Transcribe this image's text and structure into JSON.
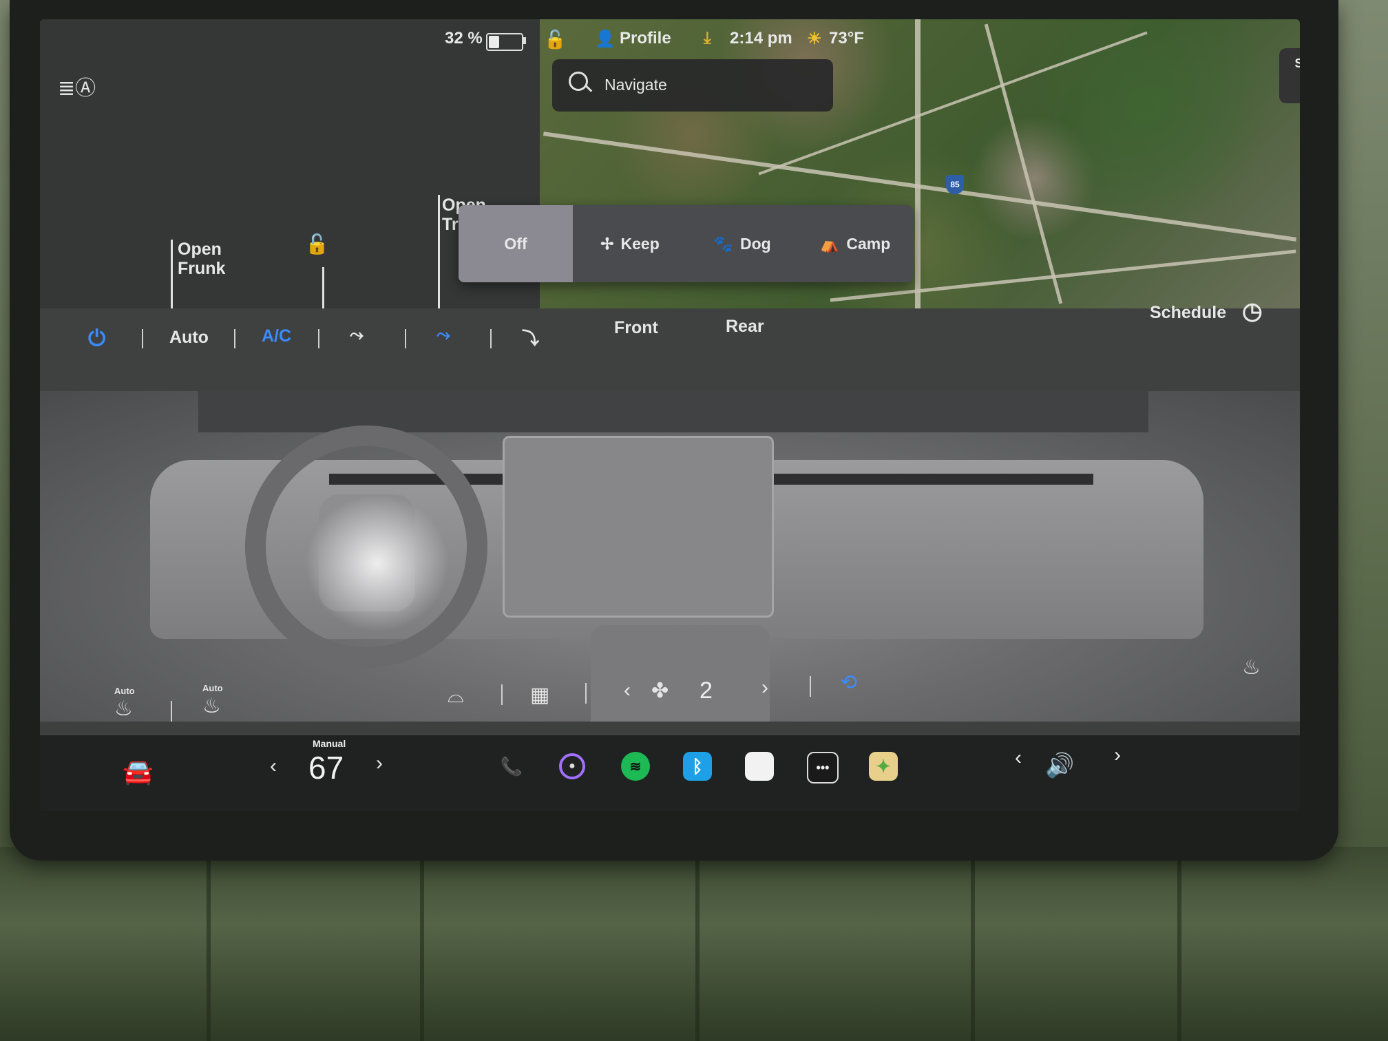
{
  "status_bar": {
    "battery_percent": "32 %",
    "battery_level": 0.32,
    "profile_label": "Profile",
    "time": "2:14 pm",
    "temperature": "73°F"
  },
  "left_panel": {
    "frunk_label": "Open\nFrunk",
    "trunk_label": "Open\nTr"
  },
  "map": {
    "search_placeholder": "Navigate",
    "compass_label": "SW",
    "highway_shield": "85"
  },
  "mode_popup": {
    "options": [
      "Off",
      "Keep",
      "Dog",
      "Camp"
    ],
    "selected": "Off"
  },
  "climate": {
    "auto_label": "Auto",
    "ac_label": "A/C",
    "front_label": "Front",
    "rear_label": "Rear",
    "schedule_label": "Schedule",
    "seat_left_mode": "Auto",
    "steering_heat_mode": "Auto",
    "fan_speed": "2",
    "accent_color": "#3a8cff"
  },
  "dock": {
    "temp_mode": "Manual",
    "temp_value": "67",
    "apps": [
      "phone-icon",
      "camera-icon",
      "spotify-icon",
      "bluetooth-icon",
      "notes-icon",
      "more-icon",
      "toybox-icon"
    ]
  }
}
